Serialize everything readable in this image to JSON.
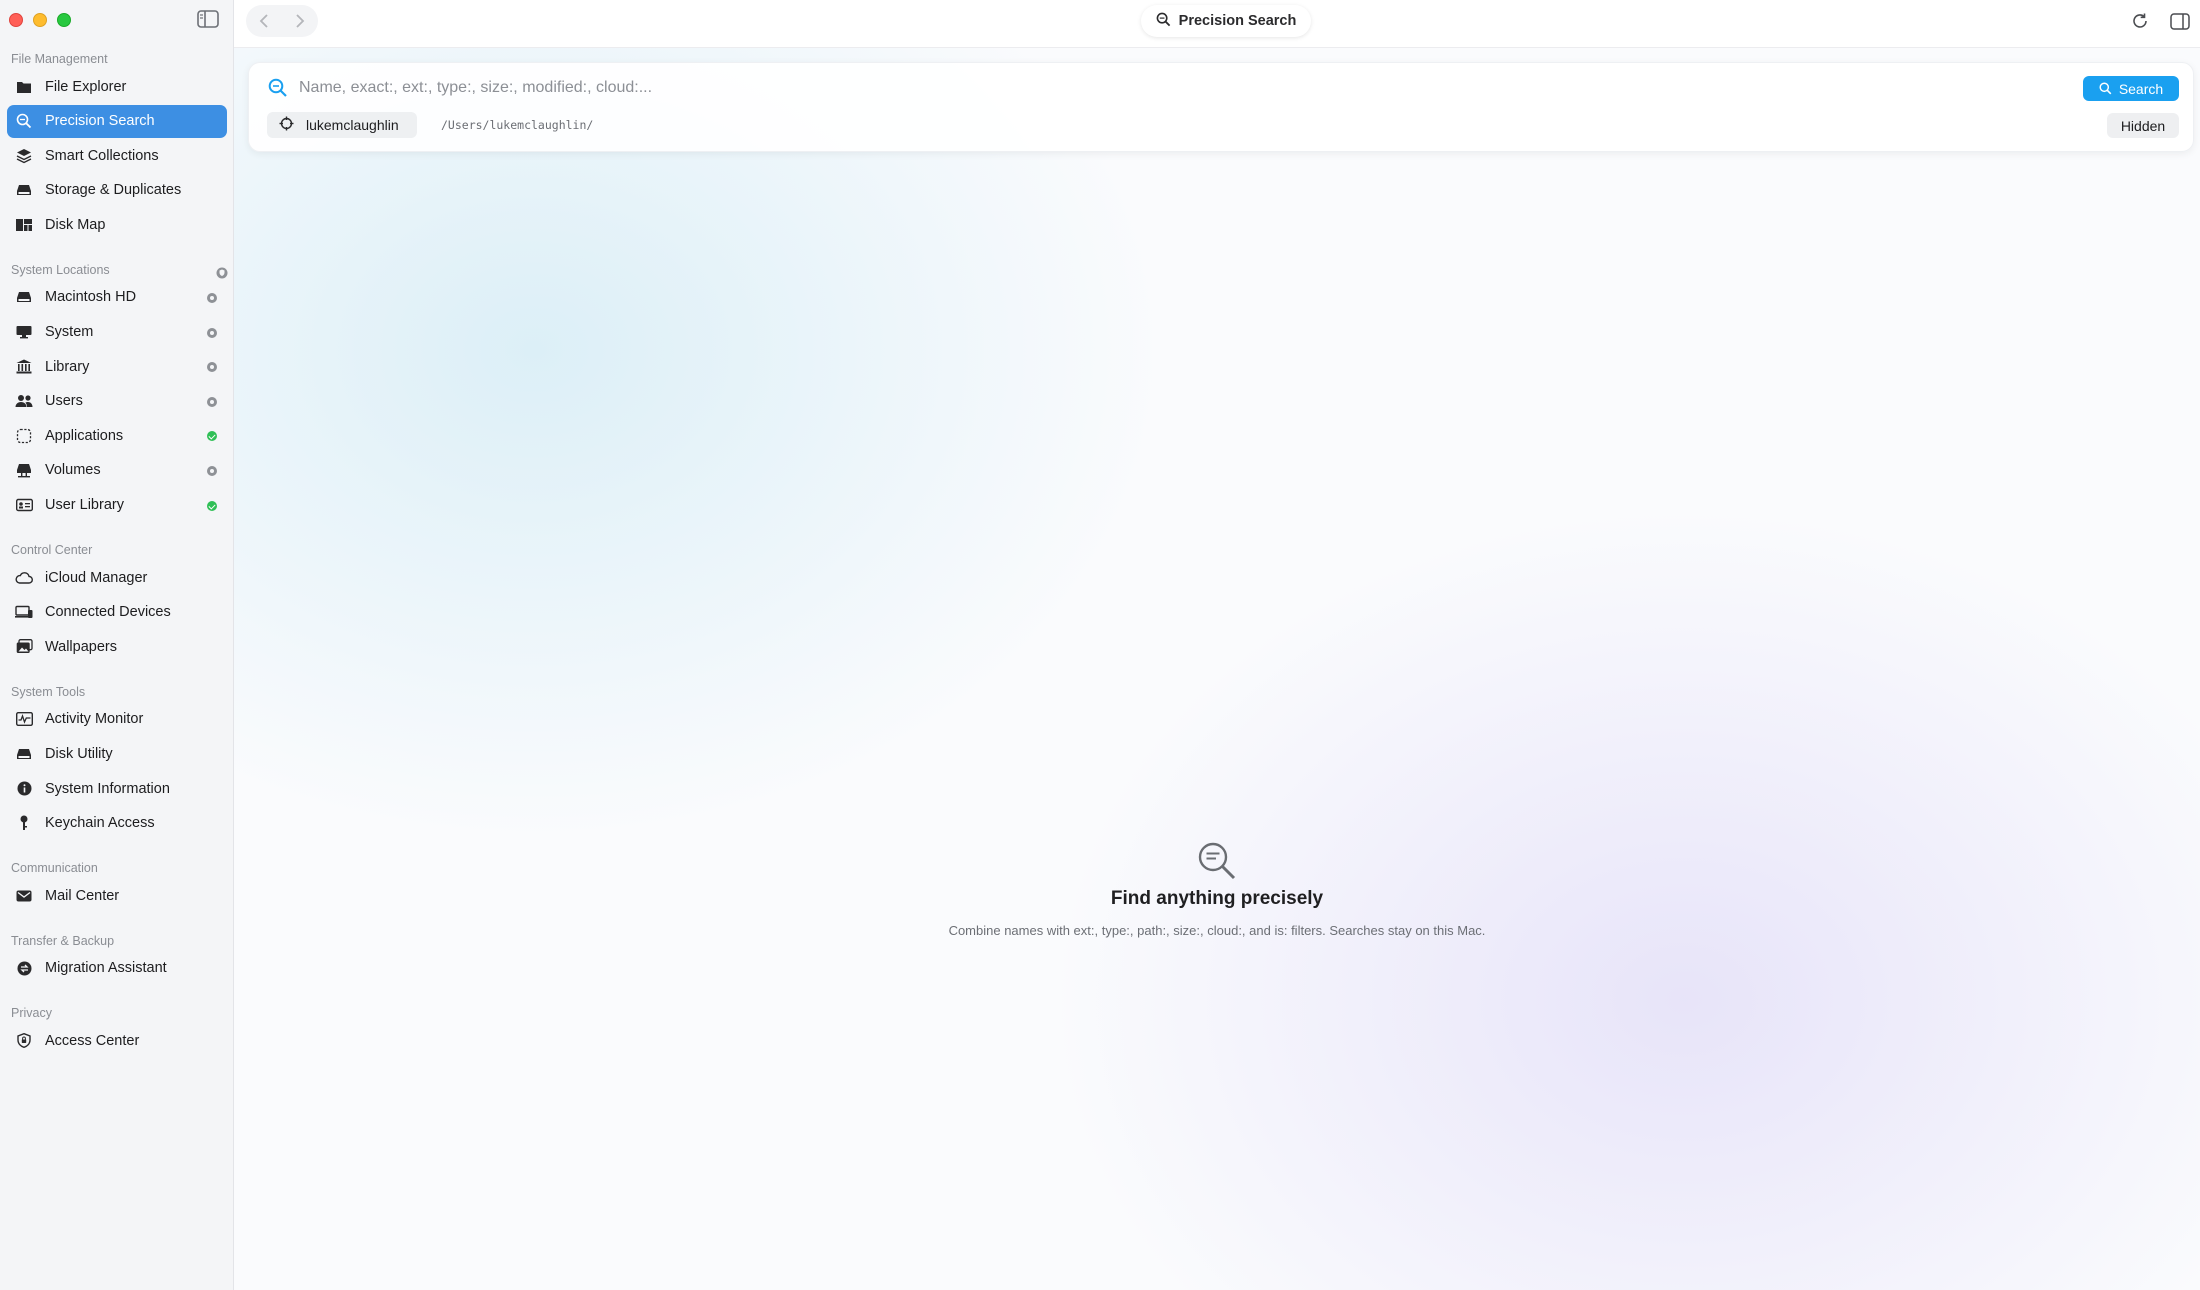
{
  "toolbar": {
    "title": "Precision Search"
  },
  "sidebar": {
    "sections": [
      {
        "label": "File Management"
      },
      {
        "label": "System Locations"
      },
      {
        "label": "Control Center"
      },
      {
        "label": "System Tools"
      },
      {
        "label": "Communication"
      },
      {
        "label": "Transfer & Backup"
      },
      {
        "label": "Privacy"
      }
    ],
    "items": {
      "file_explorer": "File Explorer",
      "precision_search": "Precision Search",
      "smart_collections": "Smart Collections",
      "storage_duplicates": "Storage & Duplicates",
      "disk_map": "Disk Map",
      "macintosh_hd": "Macintosh HD",
      "system": "System",
      "library": "Library",
      "users": "Users",
      "applications": "Applications",
      "volumes": "Volumes",
      "user_library": "User Library",
      "icloud_manager": "iCloud Manager",
      "connected_devices": "Connected Devices",
      "wallpapers": "Wallpapers",
      "activity_monitor": "Activity Monitor",
      "disk_utility": "Disk Utility",
      "system_information": "System Information",
      "keychain_access": "Keychain Access",
      "mail_center": "Mail Center",
      "migration_assistant": "Migration Assistant",
      "access_center": "Access Center"
    }
  },
  "search": {
    "value": "",
    "placeholder": "Name, exact:, ext:, type:, size:, modified:, cloud:...",
    "button_label": "Search",
    "scope_user": "lukemclaughlin",
    "scope_path": "/Users/lukemclaughlin/",
    "hidden_label": "Hidden"
  },
  "empty_state": {
    "title": "Find anything precisely",
    "subtitle": "Combine names with ext:, type:, path:, size:, cloud:, and is: filters. Searches stay on this Mac."
  },
  "colors": {
    "accent": "#3d8fe3",
    "search_button": "#1aa0f0",
    "status_ok": "#2fbf56",
    "status_neutral": "#8e9196"
  }
}
